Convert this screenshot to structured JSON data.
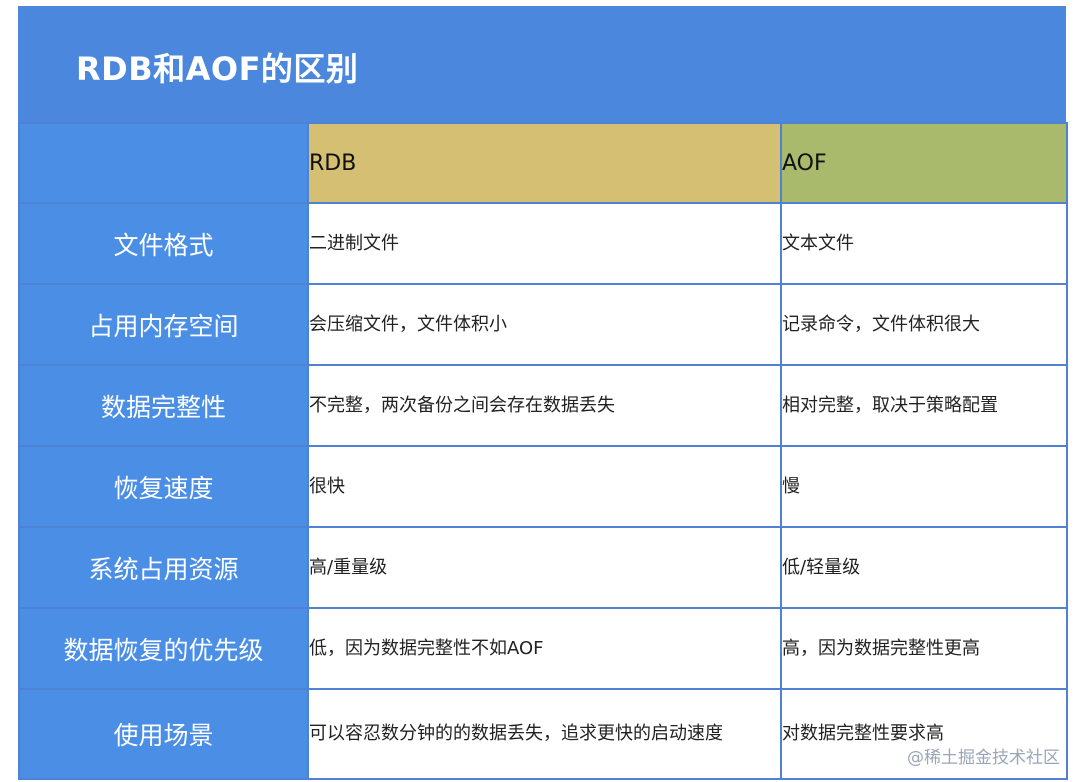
{
  "title": "RDB和AOF的区别",
  "columns": {
    "rdb": "RDB",
    "aof": "AOF"
  },
  "rows": [
    {
      "label": "文件格式",
      "rdb": "二进制文件",
      "aof": "文本文件"
    },
    {
      "label": "占用内存空间",
      "rdb": "会压缩文件，文件体积小",
      "aof": "记录命令，文件体积很大"
    },
    {
      "label": "数据完整性",
      "rdb": "不完整，两次备份之间会存在数据丢失",
      "aof": "相对完整，取决于策略配置"
    },
    {
      "label": "恢复速度",
      "rdb": "很快",
      "aof": "慢"
    },
    {
      "label": "系统占用资源",
      "rdb": "高/重量级",
      "aof": "低/轻量级"
    },
    {
      "label": "数据恢复的优先级",
      "rdb": "低，因为数据完整性不如AOF",
      "aof": "高，因为数据完整性更高"
    },
    {
      "label": "使用场景",
      "rdb": "可以容忍数分钟的的数据丢失，追求更快的启动速度",
      "aof": "对数据完整性要求高"
    }
  ],
  "watermark": "@稀土掘金技术社区"
}
